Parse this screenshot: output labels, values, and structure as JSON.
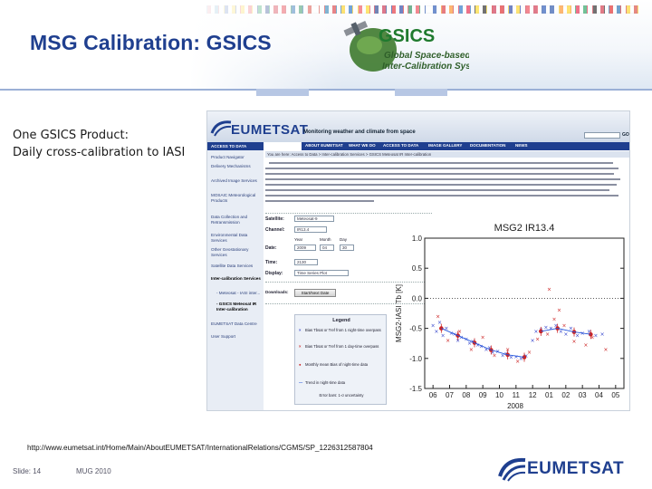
{
  "slide": {
    "title": "MSG Calibration: GSICS",
    "product_line1": "One GSICS Product:",
    "product_line2": "Daily cross-calibration to IASI",
    "url": "http://www.eumetsat.int/Home/Main/AboutEUMETSAT/InternationalRelations/CGMS/SP_1226312587804",
    "slide_number": "Slide: 14",
    "event": "MUG 2010",
    "logo_text": "EUMETSAT"
  },
  "gsics_logo": {
    "letters": "GSICS",
    "line1": "Global Space-based",
    "line2": "Inter-Calibration System"
  },
  "screenshot": {
    "logo": "EUMETSAT",
    "tagline": "Monitoring weather and climate from space",
    "search_go": "GO",
    "nav": [
      "ABOUT EUMETSAT",
      "WHAT WE DO",
      "ACCESS TO DATA",
      "IMAGE GALLERY",
      "DOCUMENTATION",
      "NEWS"
    ],
    "sidebar_head": "ACCESS TO DATA",
    "sidebar": [
      "Product Navigator",
      "Delivery Mechanisms",
      "Archived Image Services",
      "MOSAIC Meteorological Products",
      "Data Collection and Retransmission",
      "Environmental Data Services",
      "Other Geostationary Services",
      "Satellite Data Services",
      "Inter-calibration Services",
      "- Meteosat - IASI inter...",
      "- GSICS Meteosat IR Inter-calibration",
      "EUMETSAT Data Centre",
      "User Support"
    ],
    "crumb": "You are here: Access to Data > Inter-calibration Services > GSICS Meteosat IR Inter-calibration",
    "form": {
      "satellite_label": "Satellite:",
      "satellite_value": "Meteosat-9",
      "channel_label": "Channel:",
      "channel_value": "IR13.4",
      "date_label": "Date:",
      "year_label": "Year",
      "month_label": "Month",
      "day_label": "Day",
      "year_value": "2009",
      "month_value": "04",
      "day_value": "30",
      "time_label": "Time:",
      "time_value": "2130",
      "display_label": "Display:",
      "display_value": "Time Series Plot",
      "download_label": "Downloads:",
      "button": "Start/Next Date"
    },
    "legend": {
      "title": "Legend",
      "rows": [
        "Bias Tbsat or Tref from 1 night-time overpass",
        "Bias Tbsat or Tref from 1 day-time overpass",
        "Monthly mean Bias of night-time data",
        "Trend in night-time data",
        "Error bars: 1-σ uncertainty"
      ]
    }
  },
  "chart_data": {
    "type": "scatter",
    "title": "MSG2 IR13.4",
    "ylabel": "MSG2-IASI Tb [K]",
    "xlabel": "2008",
    "x_ticks": [
      "06",
      "07",
      "08",
      "09",
      "10",
      "11",
      "12",
      "01",
      "02",
      "03",
      "04",
      "05"
    ],
    "ylim": [
      -1.5,
      1.0
    ],
    "y_ticks": [
      "1.0",
      "0.5",
      "0.0",
      "-0.5",
      "-1.0",
      "-1.5"
    ],
    "series": [
      {
        "values": [
          [
            0.0,
            -0.45
          ],
          [
            0.2,
            -0.55
          ],
          [
            0.4,
            -0.4
          ],
          [
            0.6,
            -0.62
          ],
          [
            0.8,
            -0.5
          ],
          [
            1.1,
            -0.58
          ],
          [
            1.3,
            -0.6
          ],
          [
            1.5,
            -0.7
          ],
          [
            1.7,
            -0.65
          ],
          [
            2.0,
            -0.68
          ],
          [
            2.2,
            -0.75
          ],
          [
            2.4,
            -0.72
          ],
          [
            2.7,
            -0.78
          ],
          [
            2.9,
            -0.8
          ],
          [
            3.2,
            -0.85
          ],
          [
            3.4,
            -0.82
          ],
          [
            3.6,
            -0.9
          ],
          [
            3.9,
            -0.88
          ],
          [
            4.2,
            -0.95
          ],
          [
            4.4,
            -0.92
          ],
          [
            4.7,
            -0.98
          ],
          [
            5.0,
            -0.97
          ],
          [
            5.3,
            -1.0
          ],
          [
            5.6,
            -0.96
          ],
          [
            6.0,
            -0.7
          ],
          [
            6.2,
            -0.55
          ],
          [
            6.5,
            -0.52
          ],
          [
            6.8,
            -0.48
          ],
          [
            7.1,
            -0.5
          ],
          [
            7.4,
            -0.45
          ],
          [
            7.7,
            -0.55
          ],
          [
            8.0,
            -0.6
          ],
          [
            8.3,
            -0.5
          ],
          [
            8.7,
            -0.62
          ],
          [
            9.0,
            -0.58
          ],
          [
            9.4,
            -0.55
          ],
          [
            9.8,
            -0.62
          ],
          [
            10.2,
            -0.6
          ]
        ]
      },
      {
        "values": [
          [
            0.3,
            -0.3
          ],
          [
            0.9,
            -0.7
          ],
          [
            1.6,
            -0.55
          ],
          [
            2.3,
            -0.85
          ],
          [
            3.0,
            -0.65
          ],
          [
            3.7,
            -0.95
          ],
          [
            4.5,
            -0.85
          ],
          [
            5.1,
            -1.05
          ],
          [
            5.8,
            -0.9
          ],
          [
            6.3,
            -0.68
          ],
          [
            6.9,
            -0.6
          ],
          [
            7.3,
            -0.35
          ],
          [
            7.9,
            -0.45
          ],
          [
            8.5,
            -0.72
          ],
          [
            9.2,
            -0.78
          ],
          [
            9.6,
            -0.65
          ],
          [
            10.4,
            -0.85
          ],
          [
            7.0,
            0.15
          ],
          [
            7.6,
            -0.2
          ]
        ]
      },
      {
        "values": [
          [
            0.5,
            -0.5
          ],
          [
            1.5,
            -0.62
          ],
          [
            2.5,
            -0.74
          ],
          [
            3.5,
            -0.86
          ],
          [
            4.5,
            -0.94
          ],
          [
            5.5,
            -0.98
          ],
          [
            6.5,
            -0.55
          ],
          [
            7.5,
            -0.5
          ],
          [
            8.5,
            -0.56
          ],
          [
            9.5,
            -0.6
          ]
        ]
      }
    ]
  }
}
